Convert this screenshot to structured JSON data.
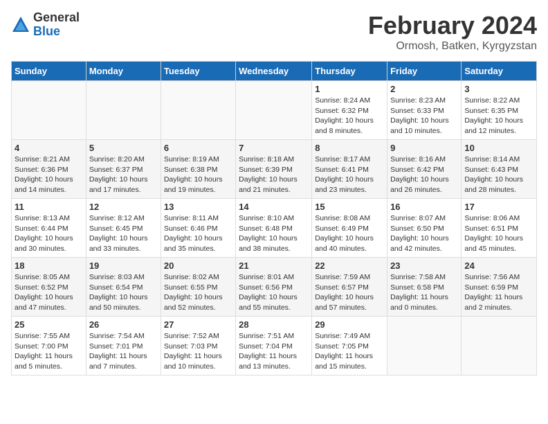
{
  "logo": {
    "general": "General",
    "blue": "Blue"
  },
  "title": "February 2024",
  "location": "Ormosh, Batken, Kyrgyzstan",
  "days_of_week": [
    "Sunday",
    "Monday",
    "Tuesday",
    "Wednesday",
    "Thursday",
    "Friday",
    "Saturday"
  ],
  "weeks": [
    [
      {
        "day": "",
        "info": ""
      },
      {
        "day": "",
        "info": ""
      },
      {
        "day": "",
        "info": ""
      },
      {
        "day": "",
        "info": ""
      },
      {
        "day": "1",
        "info": "Sunrise: 8:24 AM\nSunset: 6:32 PM\nDaylight: 10 hours\nand 8 minutes."
      },
      {
        "day": "2",
        "info": "Sunrise: 8:23 AM\nSunset: 6:33 PM\nDaylight: 10 hours\nand 10 minutes."
      },
      {
        "day": "3",
        "info": "Sunrise: 8:22 AM\nSunset: 6:35 PM\nDaylight: 10 hours\nand 12 minutes."
      }
    ],
    [
      {
        "day": "4",
        "info": "Sunrise: 8:21 AM\nSunset: 6:36 PM\nDaylight: 10 hours\nand 14 minutes."
      },
      {
        "day": "5",
        "info": "Sunrise: 8:20 AM\nSunset: 6:37 PM\nDaylight: 10 hours\nand 17 minutes."
      },
      {
        "day": "6",
        "info": "Sunrise: 8:19 AM\nSunset: 6:38 PM\nDaylight: 10 hours\nand 19 minutes."
      },
      {
        "day": "7",
        "info": "Sunrise: 8:18 AM\nSunset: 6:39 PM\nDaylight: 10 hours\nand 21 minutes."
      },
      {
        "day": "8",
        "info": "Sunrise: 8:17 AM\nSunset: 6:41 PM\nDaylight: 10 hours\nand 23 minutes."
      },
      {
        "day": "9",
        "info": "Sunrise: 8:16 AM\nSunset: 6:42 PM\nDaylight: 10 hours\nand 26 minutes."
      },
      {
        "day": "10",
        "info": "Sunrise: 8:14 AM\nSunset: 6:43 PM\nDaylight: 10 hours\nand 28 minutes."
      }
    ],
    [
      {
        "day": "11",
        "info": "Sunrise: 8:13 AM\nSunset: 6:44 PM\nDaylight: 10 hours\nand 30 minutes."
      },
      {
        "day": "12",
        "info": "Sunrise: 8:12 AM\nSunset: 6:45 PM\nDaylight: 10 hours\nand 33 minutes."
      },
      {
        "day": "13",
        "info": "Sunrise: 8:11 AM\nSunset: 6:46 PM\nDaylight: 10 hours\nand 35 minutes."
      },
      {
        "day": "14",
        "info": "Sunrise: 8:10 AM\nSunset: 6:48 PM\nDaylight: 10 hours\nand 38 minutes."
      },
      {
        "day": "15",
        "info": "Sunrise: 8:08 AM\nSunset: 6:49 PM\nDaylight: 10 hours\nand 40 minutes."
      },
      {
        "day": "16",
        "info": "Sunrise: 8:07 AM\nSunset: 6:50 PM\nDaylight: 10 hours\nand 42 minutes."
      },
      {
        "day": "17",
        "info": "Sunrise: 8:06 AM\nSunset: 6:51 PM\nDaylight: 10 hours\nand 45 minutes."
      }
    ],
    [
      {
        "day": "18",
        "info": "Sunrise: 8:05 AM\nSunset: 6:52 PM\nDaylight: 10 hours\nand 47 minutes."
      },
      {
        "day": "19",
        "info": "Sunrise: 8:03 AM\nSunset: 6:54 PM\nDaylight: 10 hours\nand 50 minutes."
      },
      {
        "day": "20",
        "info": "Sunrise: 8:02 AM\nSunset: 6:55 PM\nDaylight: 10 hours\nand 52 minutes."
      },
      {
        "day": "21",
        "info": "Sunrise: 8:01 AM\nSunset: 6:56 PM\nDaylight: 10 hours\nand 55 minutes."
      },
      {
        "day": "22",
        "info": "Sunrise: 7:59 AM\nSunset: 6:57 PM\nDaylight: 10 hours\nand 57 minutes."
      },
      {
        "day": "23",
        "info": "Sunrise: 7:58 AM\nSunset: 6:58 PM\nDaylight: 11 hours\nand 0 minutes."
      },
      {
        "day": "24",
        "info": "Sunrise: 7:56 AM\nSunset: 6:59 PM\nDaylight: 11 hours\nand 2 minutes."
      }
    ],
    [
      {
        "day": "25",
        "info": "Sunrise: 7:55 AM\nSunset: 7:00 PM\nDaylight: 11 hours\nand 5 minutes."
      },
      {
        "day": "26",
        "info": "Sunrise: 7:54 AM\nSunset: 7:01 PM\nDaylight: 11 hours\nand 7 minutes."
      },
      {
        "day": "27",
        "info": "Sunrise: 7:52 AM\nSunset: 7:03 PM\nDaylight: 11 hours\nand 10 minutes."
      },
      {
        "day": "28",
        "info": "Sunrise: 7:51 AM\nSunset: 7:04 PM\nDaylight: 11 hours\nand 13 minutes."
      },
      {
        "day": "29",
        "info": "Sunrise: 7:49 AM\nSunset: 7:05 PM\nDaylight: 11 hours\nand 15 minutes."
      },
      {
        "day": "",
        "info": ""
      },
      {
        "day": "",
        "info": ""
      }
    ]
  ]
}
